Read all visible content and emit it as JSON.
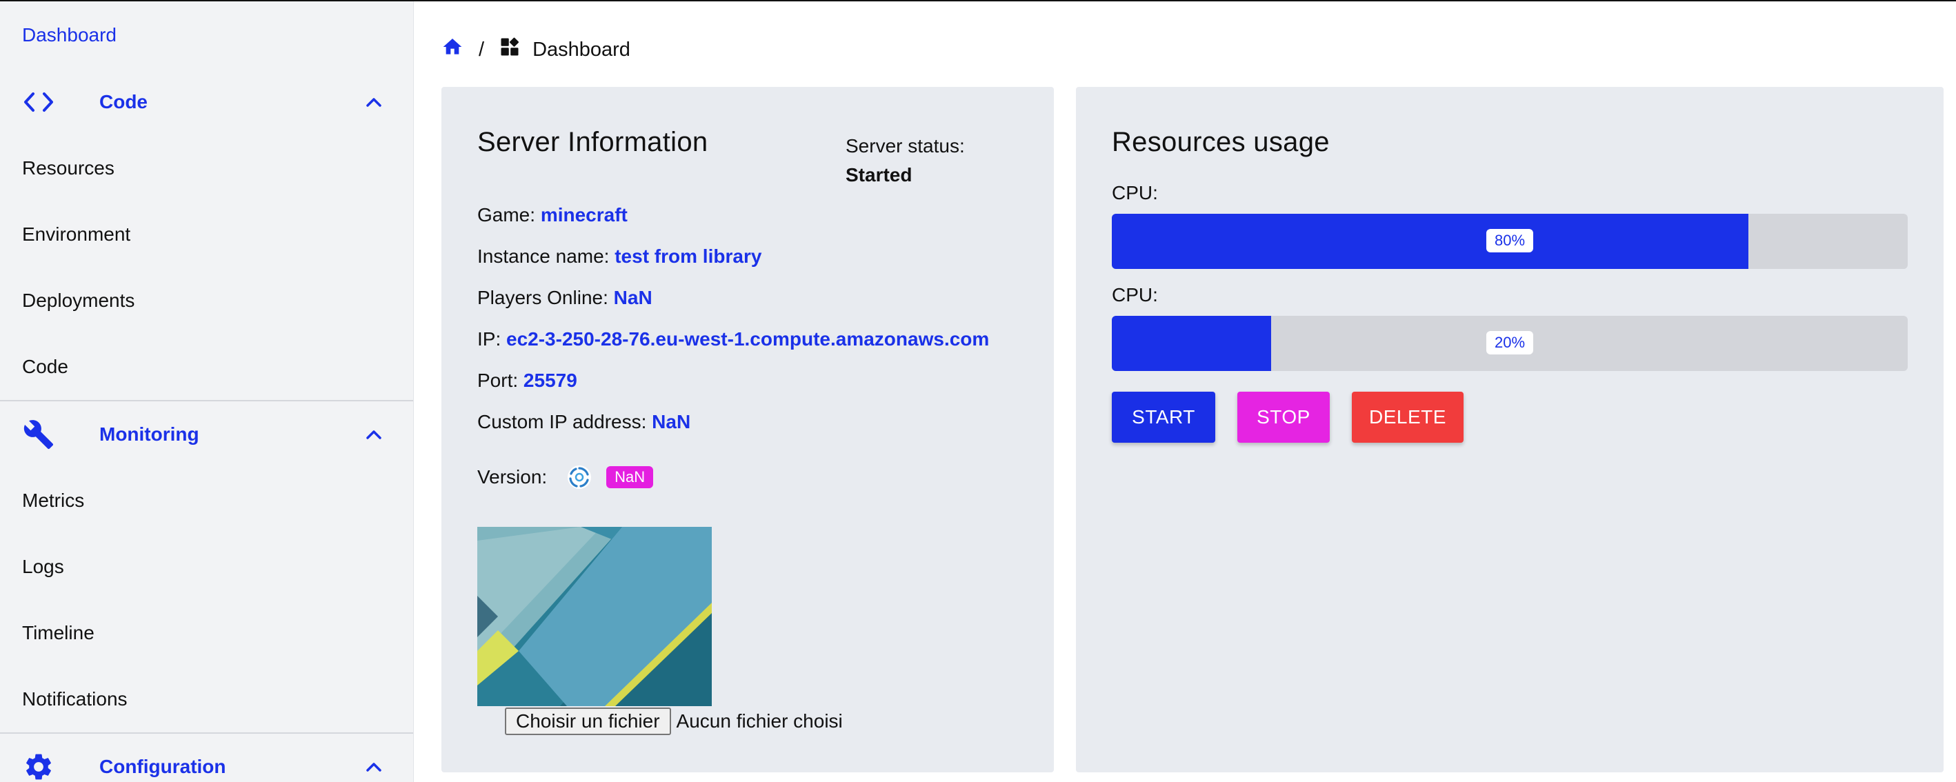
{
  "sidebar": {
    "dashboard": "Dashboard",
    "code_section": "Code",
    "code_items": [
      "Resources",
      "Environment",
      "Deployments",
      "Code"
    ],
    "monitoring_section": "Monitoring",
    "monitoring_items": [
      "Metrics",
      "Logs",
      "Timeline",
      "Notifications"
    ],
    "configuration_section": "Configuration"
  },
  "breadcrumb": {
    "separator": "/",
    "current": "Dashboard"
  },
  "server": {
    "title": "Server Information",
    "status_label": "Server status:",
    "status_value": "Started",
    "game_label": "Game:",
    "game_value": "minecraft",
    "instance_label": "Instance name:",
    "instance_value": "test from library",
    "players_label": "Players Online:",
    "players_value": "NaN",
    "ip_label": "IP:",
    "ip_value": "ec2-3-250-28-76.eu-west-1.compute.amazonaws.com",
    "port_label": "Port:",
    "port_value": "25579",
    "custom_ip_label": "Custom IP address:",
    "custom_ip_value": "NaN",
    "version_label": "Version:",
    "version_badge": "NaN",
    "file_button": "Choisir un fichier",
    "file_status": "Aucun fichier choisi"
  },
  "resources": {
    "title": "Resources usage",
    "bars": [
      {
        "label": "CPU:",
        "percent": 80,
        "text": "80%"
      },
      {
        "label": "CPU:",
        "percent": 20,
        "text": "20%"
      }
    ],
    "buttons": {
      "start": "START",
      "stop": "STOP",
      "delete": "DELETE"
    }
  },
  "colors": {
    "accent": "#1a31e8",
    "stop": "#e524e2",
    "delete": "#f13c3c",
    "card_bg": "#e8ebf0"
  }
}
